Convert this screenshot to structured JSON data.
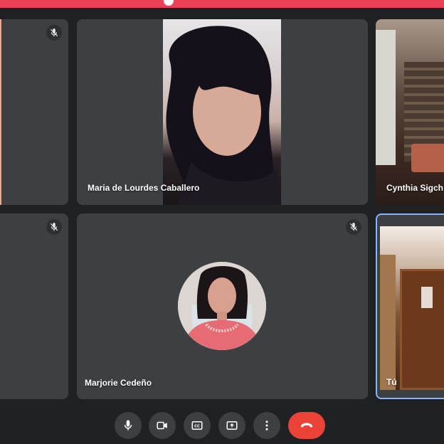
{
  "participants": [
    {
      "name": "",
      "muted": true
    },
    {
      "name": "Maria de Lourdes Caballero",
      "muted": false
    },
    {
      "name": "Cynthia Sigch",
      "muted": false
    },
    {
      "name": "",
      "muted": true
    },
    {
      "name": "Marjorie Cedeño",
      "muted": true
    },
    {
      "name": "Tú",
      "muted": false,
      "active_speaker_border": "#8ab4f8"
    }
  ],
  "controls": [
    {
      "icon": "microphone-icon"
    },
    {
      "icon": "camera-icon"
    },
    {
      "icon": "captions-icon"
    },
    {
      "icon": "present-screen-icon"
    },
    {
      "icon": "more-options-icon"
    },
    {
      "icon": "end-call-icon",
      "color": "#ea4335"
    }
  ],
  "colors": {
    "background": "#202124",
    "tile": "#3c4043",
    "top_bar": "#e94256",
    "end_call": "#ea4335",
    "active_border": "#8ab4f8"
  }
}
